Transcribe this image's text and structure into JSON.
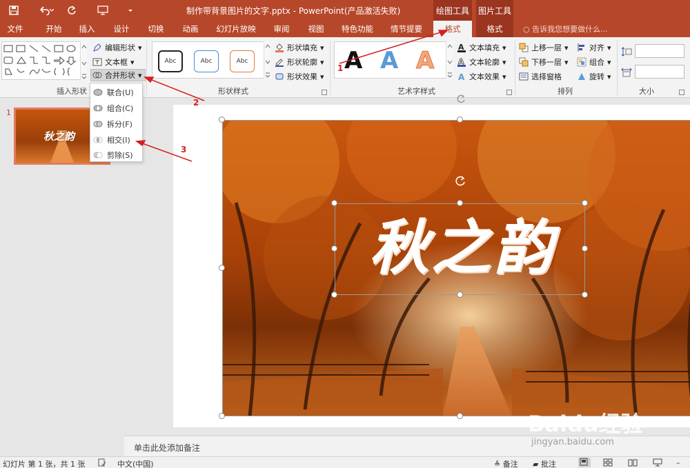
{
  "window": {
    "title": "制作带背景图片的文字.pptx - PowerPoint(产品激活失败)",
    "context_groups": [
      "绘图工具",
      "图片工具"
    ]
  },
  "tabs": [
    "文件",
    "开始",
    "插入",
    "设计",
    "切换",
    "动画",
    "幻灯片放映",
    "审阅",
    "视图",
    "特色功能",
    "情节提要",
    "格式",
    "格式"
  ],
  "tell_me": "告诉我您想要做什么...",
  "ribbon": {
    "insert_shapes": {
      "label": "插入形状",
      "edit_shape": "编辑形状",
      "text_box": "文本框",
      "merge_shapes": "合并形状"
    },
    "shape_styles": {
      "label": "形状样式",
      "swatch_text": "Abc",
      "fill": "形状填充",
      "outline": "形状轮廓",
      "effects": "形状效果"
    },
    "wordart_styles": {
      "label": "艺术字样式",
      "letter": "A",
      "text_fill": "文本填充",
      "text_outline": "文本轮廓",
      "text_effects": "文本效果"
    },
    "arrange": {
      "label": "排列",
      "bring_forward": "上移一层",
      "send_backward": "下移一层",
      "selection_pane": "选择窗格",
      "align": "对齐",
      "group": "组合",
      "rotate": "旋转"
    },
    "size": {
      "label": "大小"
    }
  },
  "merge_menu": {
    "items": [
      "联合(U)",
      "组合(C)",
      "拆分(F)",
      "相交(I)",
      "剪除(S)"
    ]
  },
  "slides_pane": {
    "slide_number": "1",
    "thumb_text": "秋之韵"
  },
  "slide": {
    "text": "秋之韵"
  },
  "notes": {
    "placeholder": "单击此处添加备注"
  },
  "status": {
    "slide_info": "幻灯片 第 1 张，共 1 张",
    "language": "中文(中国)",
    "notes": "备注",
    "comments": "批注"
  },
  "annotations": [
    "1",
    "2",
    "3",
    "1"
  ],
  "watermark": {
    "brand": "Baidu经验",
    "url": "jingyan.baidu.com"
  },
  "colors": {
    "accent": "#b7472a",
    "annotation": "#d42020"
  }
}
